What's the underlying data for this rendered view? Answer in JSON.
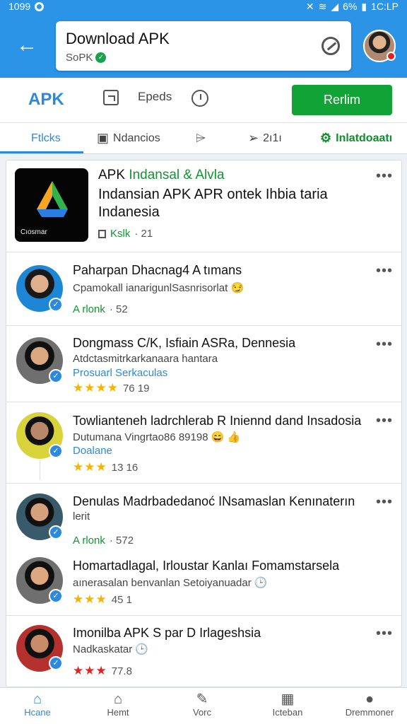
{
  "status_bar": {
    "time": "1099",
    "battery": "6%",
    "right_time": "1C:LP"
  },
  "app_bar": {
    "title": "Download APK",
    "subtitle": "SoPK",
    "back_icon": "arrow-left-icon",
    "clear_icon": "clear-icon"
  },
  "toolbar": {
    "brand": "APK",
    "tool_label": "Epeds",
    "refresh_label": "Rerlim"
  },
  "tabs": [
    {
      "label": "Ftlcks"
    },
    {
      "label": "Ndancios"
    },
    {
      "label": ""
    },
    {
      "label": "2ı1ı"
    },
    {
      "label": "Inlatdoaatı"
    }
  ],
  "featured": {
    "title_black": "APK",
    "title_green": "Indansal & Alvla",
    "description": "Indansian APK APR ontek Ihbia taria Indanesia",
    "meta_label": "Kslk",
    "meta_count": "· 21",
    "logo_caption": "Cıosmar"
  },
  "items": [
    {
      "title": "Paharpan Dhacnag4 A tımans",
      "subtitle": "Cpamokall ianarigunlSasnrisorlat 😏",
      "meta_label": "A rlonk",
      "meta_count": "· 52"
    },
    {
      "title": "Dongmass C/K, Isfiain ASRa, Dennesia",
      "subtitle": "Atdctasmitrkarkanaara hantara",
      "tag": "Prosuarl Serkaculas",
      "stars": "★★★★",
      "rating": "76 19"
    },
    {
      "title": "Towlianteneh ladrchlerab R Iniennd dand Insadosia",
      "subtitle": "Dutumana Vingrtao86 89198 😄 👍",
      "tag": "Doalane",
      "stars": "★★★",
      "rating": "13 16"
    },
    {
      "title": "Denulas Madrbadedanoć INsamaslan Kenınaterın",
      "subtitle": "lerit",
      "meta_label": "A rlonk",
      "meta_count": "· 572"
    },
    {
      "title": "Homartadlagal, Irloustar Kanlaı Fomamstarsela",
      "subtitle": "aınerasalan benvanlan Setoiyanuadar 🕒",
      "stars": "★★★",
      "rating": "45 1"
    },
    {
      "title": "Imonilba APK S par D Irlageshsia",
      "subtitle": "Nadkaskatar 🕒",
      "stars": "★★★",
      "rating": "77.8"
    }
  ],
  "bottom_nav": [
    {
      "label": "Hcane",
      "icon": "home-icon"
    },
    {
      "label": "Hemt",
      "icon": "house-outline-icon"
    },
    {
      "label": "Vorc",
      "icon": "edit-icon"
    },
    {
      "label": "Icteban",
      "icon": "grid-icon"
    },
    {
      "label": "Dremmoner",
      "icon": "profile-icon"
    }
  ]
}
